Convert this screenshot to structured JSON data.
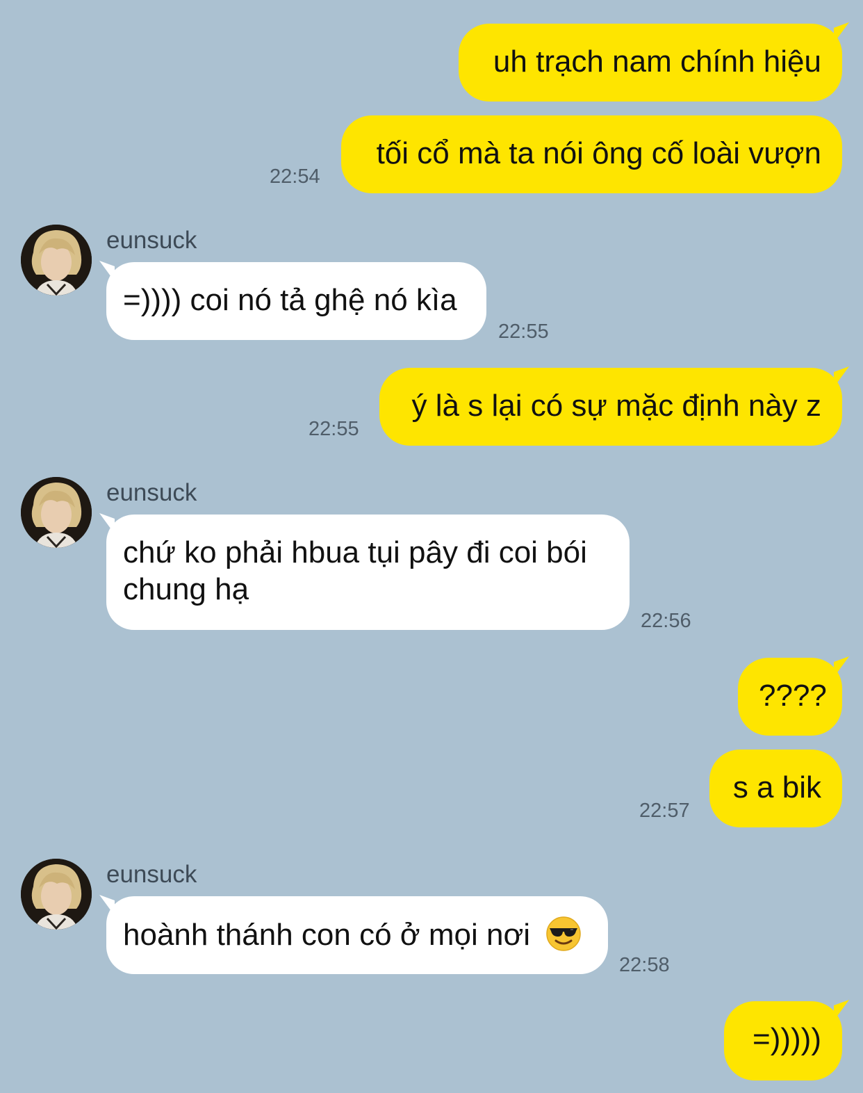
{
  "contact": {
    "name": "eunsuck",
    "avatar_icon": "profile-photo-icon"
  },
  "colors": {
    "background": "#abc1d1",
    "outgoing_bubble": "#fee500",
    "incoming_bubble": "#ffffff"
  },
  "messages": [
    {
      "dir": "out",
      "text": "uh trạch nam chính hiệu"
    },
    {
      "dir": "out",
      "text": "tối cổ mà ta nói ông cố loài vượn",
      "time": "22:54"
    },
    {
      "dir": "in",
      "sender": "eunsuck",
      "text": "=)))) coi nó tả ghệ nó kìa",
      "time": "22:55"
    },
    {
      "dir": "out",
      "text": "ý là s lại có sự mặc định này z",
      "time": "22:55"
    },
    {
      "dir": "in",
      "sender": "eunsuck",
      "text_line1": "chứ ko phải hbua tụi pây đi coi bói",
      "text_line2": "chung hạ",
      "time": "22:56"
    },
    {
      "dir": "out",
      "text": "????"
    },
    {
      "dir": "out",
      "text": "s a bik",
      "time": "22:57"
    },
    {
      "dir": "in",
      "sender": "eunsuck",
      "text": "hoành thánh con có ở mọi nơi",
      "emoji": "smiling-face-with-sunglasses-icon",
      "time": "22:58"
    },
    {
      "dir": "out",
      "text": "=)))))"
    }
  ]
}
